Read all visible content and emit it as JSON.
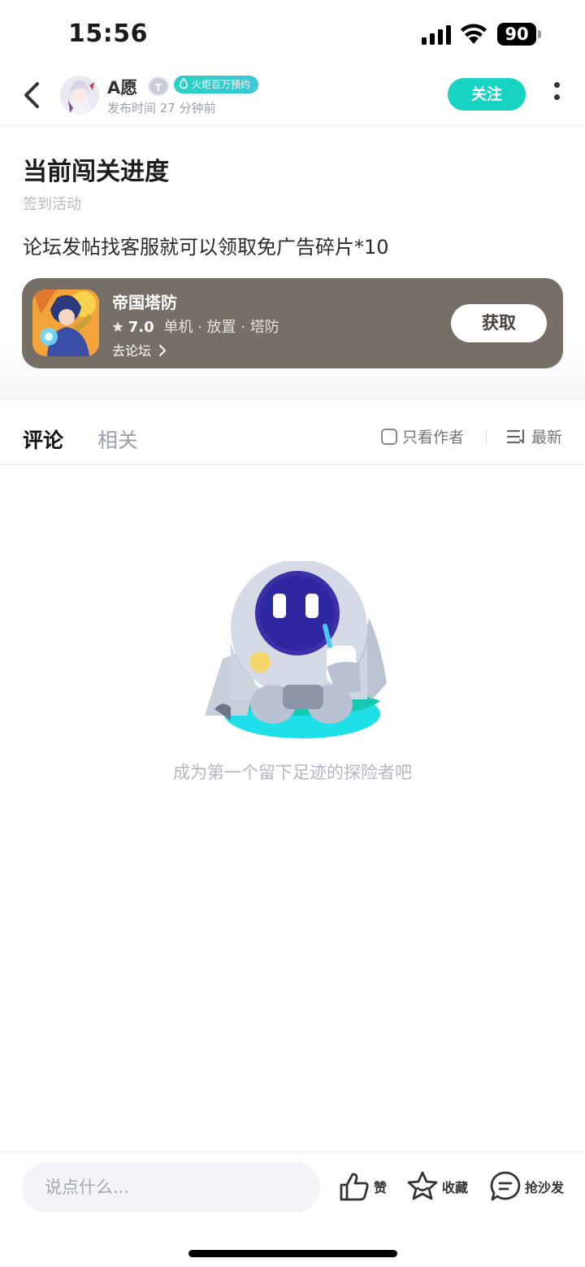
{
  "status_bar": {
    "time": "15:56",
    "battery": "90"
  },
  "header": {
    "author_name": "A愿",
    "level_badge": "T",
    "tag_badge": "火炬百万预约",
    "post_time": "发布时间 27 分钟前",
    "follow_label": "关注"
  },
  "post": {
    "title": "当前闯关进度",
    "category": "签到活动",
    "content": "论坛发帖找客服就可以领取免广告碎片*10"
  },
  "game_card": {
    "name": "帝国塔防",
    "rating": "7.0",
    "tags": "单机 · 放置 · 塔防",
    "forum_link": "去论坛",
    "get_label": "获取",
    "bg_color": "#756f66"
  },
  "tabs": {
    "comments": "评论",
    "related": "相关",
    "author_only": "只看作者",
    "sort": "最新",
    "accent_color": "#1fe0d0"
  },
  "empty_state": {
    "message": "成为第一个留下足迹的探险者吧"
  },
  "bottom_bar": {
    "input_placeholder": "说点什么...",
    "like_label": "赞",
    "favorite_label": "收藏",
    "sofa_label": "抢沙发"
  }
}
